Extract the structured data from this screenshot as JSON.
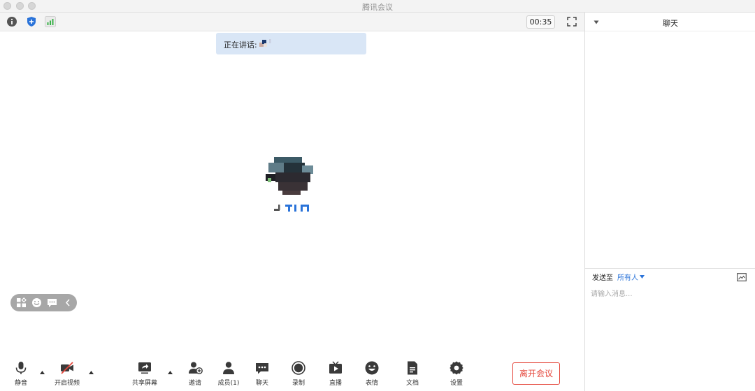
{
  "window": {
    "title": "腾讯会议"
  },
  "meeting": {
    "timer": "00:35",
    "speaking_label": "正在讲话:"
  },
  "toolbar": {
    "mute_label": "静音",
    "video_label": "开启视频",
    "share_label": "共享屏幕",
    "invite_label": "邀请",
    "members_label": "成员(1)",
    "chat_label": "聊天",
    "record_label": "录制",
    "live_label": "直播",
    "emoji_label": "表情",
    "docs_label": "文档",
    "settings_label": "设置",
    "leave_label": "离开会议"
  },
  "chat": {
    "title": "聊天",
    "send_to_label": "发送至",
    "send_to_target": "所有人",
    "input_placeholder": "请输入消息..."
  },
  "colors": {
    "accent_blue": "#2a73d9",
    "leave_red": "#e5473c",
    "signal_green": "#3bb34a",
    "speaking_bg": "#d9e6f6"
  }
}
